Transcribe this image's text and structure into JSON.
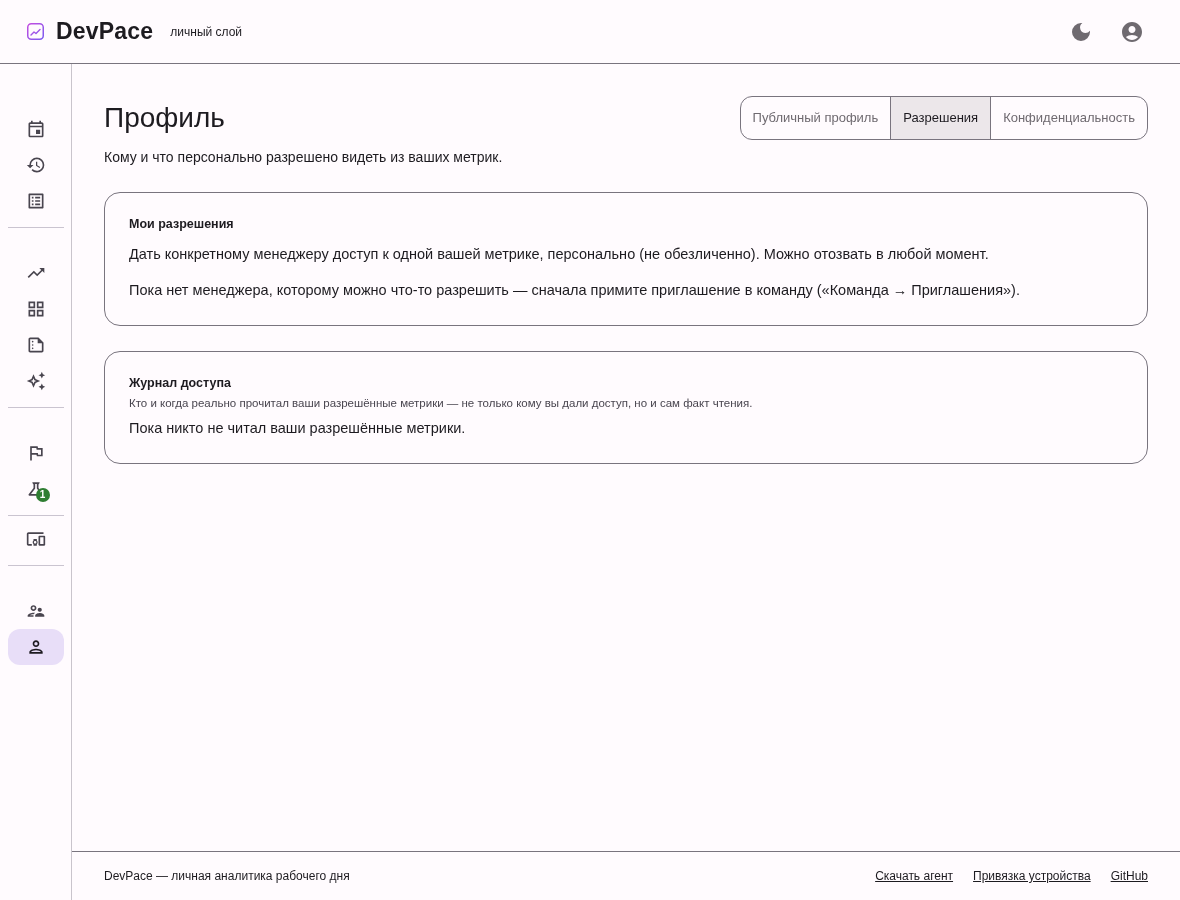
{
  "header": {
    "logo": "DevPace",
    "subtitle": "личный слой"
  },
  "sidebar": {
    "groups": [
      {
        "items": [
          {
            "selected": false
          },
          {
            "selected": false
          },
          {
            "selected": false
          }
        ]
      },
      {
        "items": [
          {
            "selected": false
          },
          {
            "selected": false
          },
          {
            "selected": false
          },
          {
            "selected": false
          }
        ]
      },
      {
        "items": [
          {
            "selected": false
          },
          {
            "selected": false,
            "badge": "1"
          }
        ]
      },
      {
        "items": [
          {
            "selected": false
          }
        ]
      },
      {
        "items": [
          {
            "selected": false
          },
          {
            "selected": true
          }
        ]
      }
    ]
  },
  "page": {
    "title": "Профиль",
    "description": "Кому и что персонально разрешено видеть из ваших метрик."
  },
  "tabs": [
    {
      "label": "Публичный профиль",
      "selected": false
    },
    {
      "label": "Разрешения",
      "selected": true
    },
    {
      "label": "Конфиденциальность",
      "selected": false
    }
  ],
  "cards": [
    {
      "title": "Мои разрешения",
      "blocks": [
        {
          "kind": "body",
          "text": "Дать конкретному менеджеру доступ к одной вашей метрике, персонально (не обезличенно). Можно отозвать в любой момент."
        },
        {
          "kind": "body",
          "text": "Пока нет менеджера, которому можно что-то разрешить — сначала примите приглашение в команду («Команда → Приглашения»)."
        }
      ]
    },
    {
      "title": "Журнал доступа",
      "blocks": [
        {
          "kind": "caption",
          "text": "Кто и когда реально прочитал ваши разрешённые метрики — не только кому вы дали доступ, но и сам факт чтения."
        },
        {
          "kind": "body",
          "text": "Пока никто не читал ваши разрешённые метрики."
        }
      ]
    }
  ],
  "footer": {
    "text": "DevPace — личная аналитика рабочего дня",
    "links": [
      "Скачать агент",
      "Привязка устройства",
      "GitHub"
    ]
  }
}
